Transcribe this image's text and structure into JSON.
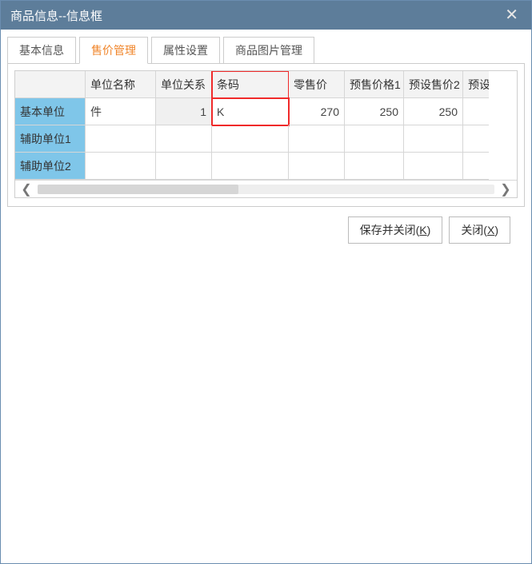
{
  "window": {
    "title": "商品信息--信息框"
  },
  "tabs": {
    "basic": "基本信息",
    "price": "售价管理",
    "attr": "属性设置",
    "image": "商品图片管理"
  },
  "grid": {
    "headers": {
      "rowlabel": "",
      "unit_name": "单位名称",
      "unit_rel": "单位关系",
      "barcode": "条码",
      "retail": "零售价",
      "preset1": "预售价格1",
      "preset2": "预设售价2",
      "preset3_cut": "预设"
    },
    "rows": [
      {
        "label": "基本单位",
        "unit_name": "件",
        "unit_rel": "1",
        "barcode": "K",
        "retail": "270",
        "preset1": "250",
        "preset2": "250",
        "preset3": ""
      },
      {
        "label": "辅助单位1",
        "unit_name": "",
        "unit_rel": "",
        "barcode": "",
        "retail": "",
        "preset1": "",
        "preset2": "",
        "preset3": ""
      },
      {
        "label": "辅助单位2",
        "unit_name": "",
        "unit_rel": "",
        "barcode": "",
        "retail": "",
        "preset1": "",
        "preset2": "",
        "preset3": ""
      }
    ]
  },
  "buttons": {
    "save_close_pre": "保存并关闭(",
    "save_close_key": "K",
    "save_close_post": ")",
    "close_pre": "关闭(",
    "close_key": "X",
    "close_post": ")"
  }
}
